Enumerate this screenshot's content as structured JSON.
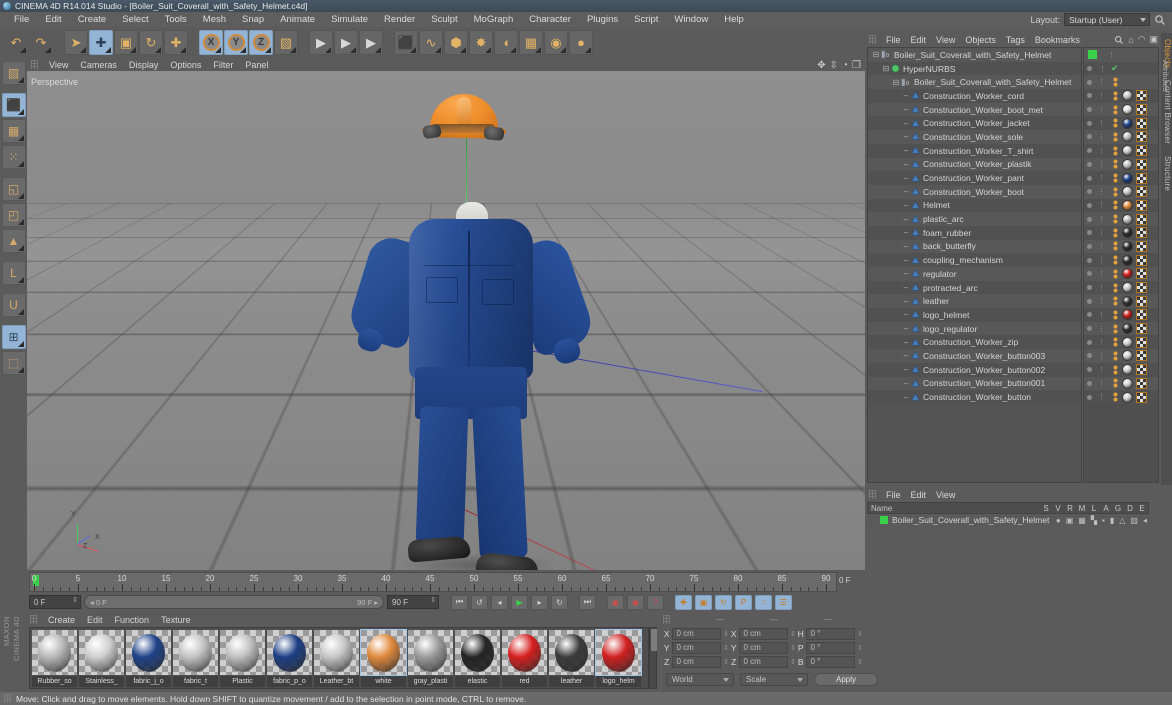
{
  "window": {
    "title": "CINEMA 4D R14.014 Studio - [Boiler_Suit_Coverall_with_Safety_Helmet.c4d]",
    "app_icon": "c4d-logo-icon"
  },
  "menubar": {
    "items": [
      "File",
      "Edit",
      "Create",
      "Select",
      "Tools",
      "Mesh",
      "Snap",
      "Animate",
      "Simulate",
      "Render",
      "Sculpt",
      "MoGraph",
      "Character",
      "Plugins",
      "Script",
      "Window",
      "Help"
    ]
  },
  "layout": {
    "label": "Layout:",
    "value": "Startup (User)"
  },
  "toolbar": {
    "groups": [
      {
        "buttons": [
          {
            "name": "undo-button",
            "glyph": "↶",
            "selected": false
          },
          {
            "name": "redo-button",
            "glyph": "↷",
            "selected": false
          }
        ]
      },
      {
        "buttons": [
          {
            "name": "live-selection-tool",
            "glyph": "➤",
            "selected": false
          },
          {
            "name": "move-tool",
            "glyph": "✚",
            "selected": true
          },
          {
            "name": "scale-tool",
            "glyph": "▣",
            "selected": false
          },
          {
            "name": "rotate-tool",
            "glyph": "↻",
            "selected": false
          },
          {
            "name": "add-point-tool",
            "glyph": "✚",
            "selected": false
          }
        ]
      },
      {
        "buttons": [
          {
            "name": "lock-x-axis-button",
            "glyph": "X",
            "selected": true
          },
          {
            "name": "lock-y-axis-button",
            "glyph": "Y",
            "selected": true
          },
          {
            "name": "lock-z-axis-button",
            "glyph": "Z",
            "selected": true
          },
          {
            "name": "world-object-coordinate-button",
            "glyph": "▧",
            "selected": false
          }
        ]
      },
      {
        "buttons": [
          {
            "name": "render-view-button",
            "glyph": "▶",
            "selected": false
          },
          {
            "name": "render-region-button",
            "glyph": "▶",
            "selected": false
          },
          {
            "name": "render-settings-button",
            "glyph": "▶",
            "selected": false
          }
        ]
      },
      {
        "buttons": [
          {
            "name": "add-cube-object-button",
            "glyph": "⬛",
            "selected": false
          },
          {
            "name": "add-spline-button",
            "glyph": "∿",
            "selected": false
          },
          {
            "name": "add-generator-button",
            "glyph": "⬢",
            "selected": false
          },
          {
            "name": "add-deformer-button",
            "glyph": "✸",
            "selected": false
          },
          {
            "name": "add-scene-object-button",
            "glyph": "◖",
            "selected": false
          },
          {
            "name": "add-environment-button",
            "glyph": "▦",
            "selected": false
          },
          {
            "name": "add-camera-button",
            "glyph": "◉",
            "selected": false
          },
          {
            "name": "add-light-button",
            "glyph": "●",
            "selected": false
          }
        ]
      }
    ]
  },
  "left_toolbar": {
    "buttons": [
      {
        "name": "texture-axis-tool",
        "glyph": "▨",
        "selected": false
      },
      {
        "name": "model-mode-button",
        "glyph": "⬛",
        "selected": true
      },
      {
        "name": "texture-mode-button",
        "glyph": "▦",
        "selected": false
      },
      {
        "name": "points-mode-button",
        "glyph": "⁙",
        "selected": false
      },
      {
        "name": "edges-mode-button",
        "glyph": "◱",
        "selected": false
      },
      {
        "name": "polygons-mode-button",
        "glyph": "◰",
        "selected": false
      },
      {
        "name": "object-axis-mode-button",
        "glyph": "▲",
        "selected": false
      },
      {
        "name": "enable-axis-modification-button",
        "glyph": "L",
        "selected": false
      },
      {
        "name": "enable-snapping-button",
        "glyph": "U",
        "selected": false
      },
      {
        "name": "workplane-lock-button",
        "glyph": "⊞",
        "selected": true
      },
      {
        "name": "workplane-button",
        "glyph": "⬚",
        "selected": false
      }
    ]
  },
  "viewport": {
    "menu": [
      "View",
      "Cameras",
      "Display",
      "Options",
      "Filter",
      "Panel"
    ],
    "camera_label": "Perspective",
    "nav_icons": [
      "pan-icon",
      "dolly-icon",
      "rotate-icon",
      "maximize-icon"
    ],
    "axis_labels": {
      "y": "Y",
      "x": "X",
      "z": "Z"
    },
    "background_color": "#8b8b8b",
    "suit_color": "#254a90",
    "helmet_color": "#ef8f2c",
    "boot_color": "#1b1b1b"
  },
  "timeline": {
    "start_frame": "0 F",
    "end_frame": "90 F",
    "current_frame": "0 F",
    "preview_min": "0 F",
    "preview_max": "90 F",
    "tick_labels": [
      "0",
      "5",
      "10",
      "15",
      "20",
      "25",
      "30",
      "35",
      "40",
      "45",
      "50",
      "55",
      "60",
      "65",
      "70",
      "75",
      "80",
      "85",
      "90"
    ],
    "transport": [
      {
        "name": "go-to-start-button",
        "glyph": "⏮"
      },
      {
        "name": "play-backwards-loop-button",
        "glyph": "↺"
      },
      {
        "name": "go-to-previous-frame-button",
        "glyph": "◂"
      },
      {
        "name": "play-button",
        "glyph": "▶",
        "active": true
      },
      {
        "name": "go-to-next-frame-button",
        "glyph": "▸"
      },
      {
        "name": "loop-button",
        "glyph": "↻"
      },
      {
        "name": "go-to-end-button",
        "glyph": "⏭"
      },
      {
        "name": "record-active-objects-button",
        "glyph": "◉"
      },
      {
        "name": "autokeying-button",
        "glyph": "◉"
      },
      {
        "name": "keyframe-selection-button",
        "glyph": "?"
      },
      {
        "name": "position-key-button",
        "glyph": "✚",
        "on": true
      },
      {
        "name": "scale-key-button",
        "glyph": "▣",
        "on": true
      },
      {
        "name": "rotation-key-button",
        "glyph": "↻",
        "on": true
      },
      {
        "name": "parameter-key-button",
        "glyph": "P",
        "on": true
      },
      {
        "name": "point-level-animation-button",
        "glyph": "⁙",
        "on": true
      },
      {
        "name": "timeline-view-button",
        "glyph": "☰",
        "on": true
      }
    ]
  },
  "material_manager": {
    "menu": [
      "Create",
      "Edit",
      "Function",
      "Texture"
    ],
    "materials": [
      {
        "name": "Rubber_so",
        "color": "#b9b9b9",
        "selected": false
      },
      {
        "name": "Stainless_",
        "color": "#cfcfcf",
        "selected": false
      },
      {
        "name": "fabric_j_o",
        "color": "#1f4288",
        "selected": false
      },
      {
        "name": "fabric_t",
        "color": "#c3c3c3",
        "selected": false
      },
      {
        "name": "Plastic",
        "color": "#c0c0c0",
        "selected": false
      },
      {
        "name": "fabric_p_o",
        "color": "#1d3f84",
        "selected": false
      },
      {
        "name": "Leather_bt",
        "color": "#c6c6c6",
        "selected": false
      },
      {
        "name": "white",
        "color": "#e08a3d",
        "selected": true
      },
      {
        "name": "gray_plasti",
        "color": "#9a9a9a",
        "selected": false
      },
      {
        "name": "elastic",
        "color": "#242424",
        "selected": false
      },
      {
        "name": "red",
        "color": "#d61f1f",
        "selected": false
      },
      {
        "name": "leather",
        "color": "#3b3b3b",
        "selected": false
      },
      {
        "name": "logo_helm",
        "color": "#cf1f1f",
        "selected": true
      }
    ]
  },
  "coordinates": {
    "position": {
      "label_x": "X",
      "x": "0 cm",
      "label_y": "Y",
      "y": "0 cm",
      "label_z": "Z",
      "z": "0 cm"
    },
    "size": {
      "label_x": "X",
      "x": "0 cm",
      "label_y": "Y",
      "y": "0 cm",
      "label_z": "Z",
      "z": "0 cm"
    },
    "rotation": {
      "label_h": "H",
      "h": "0 °",
      "label_p": "P",
      "p": "0 °",
      "label_b": "B",
      "b": "0 °"
    },
    "system": "World",
    "mode": "Scale",
    "apply_label": "Apply",
    "column_headers": [
      "—",
      "—",
      "—"
    ]
  },
  "object_manager": {
    "menu": [
      "File",
      "Edit",
      "View",
      "Objects",
      "Tags",
      "Bookmarks"
    ],
    "header_icons": [
      "search-icon",
      "home-icon",
      "eye-icon",
      "new-object-icon"
    ],
    "rows": [
      {
        "label": "Boiler_Suit_Coverall_with_Safety_Helmet",
        "indent": 0,
        "icon": "null-object-icon",
        "layer_color": "#3ad14a",
        "tags": []
      },
      {
        "label": "HyperNURBS",
        "indent": 1,
        "icon": "hypernurbs-icon",
        "tags": [
          "check"
        ]
      },
      {
        "label": "Boiler_Suit_Coverall_with_Safety_Helmet",
        "indent": 2,
        "icon": "null-object-icon",
        "tags": [
          "dots"
        ]
      },
      {
        "label": "Construction_Worker_cord",
        "indent": 3,
        "icon": "polygon-object-icon",
        "tags": [
          "dots",
          "mat-light",
          "uv"
        ],
        "mat": "#c8c8c8"
      },
      {
        "label": "Construction_Worker_boot_met",
        "indent": 3,
        "icon": "polygon-object-icon",
        "tags": [
          "dots",
          "mat",
          "uv"
        ],
        "mat": "#dedede"
      },
      {
        "label": "Construction_Worker_jacket",
        "indent": 3,
        "icon": "polygon-object-icon",
        "tags": [
          "dots",
          "mat",
          "uv"
        ],
        "mat": "#1f4288"
      },
      {
        "label": "Construction_Worker_sole",
        "indent": 3,
        "icon": "polygon-object-icon",
        "tags": [
          "dots",
          "mat",
          "uv"
        ],
        "mat": "#bfbfbf"
      },
      {
        "label": "Construction_Worker_T_shirt",
        "indent": 3,
        "icon": "polygon-object-icon",
        "tags": [
          "dots",
          "mat",
          "uv"
        ],
        "mat": "#cccccc"
      },
      {
        "label": "Construction_Worker_plastik",
        "indent": 3,
        "icon": "polygon-object-icon",
        "tags": [
          "dots",
          "mat",
          "uv"
        ],
        "mat": "#c2c2c2"
      },
      {
        "label": "Construction_Worker_pant",
        "indent": 3,
        "icon": "polygon-object-icon",
        "tags": [
          "dots",
          "mat",
          "uv"
        ],
        "mat": "#1d3f84"
      },
      {
        "label": "Construction_Worker_boot",
        "indent": 3,
        "icon": "polygon-object-icon",
        "tags": [
          "dots",
          "mat",
          "uv"
        ],
        "mat": "#c5c5c5"
      },
      {
        "label": "Helmet",
        "indent": 3,
        "icon": "polygon-object-icon",
        "tags": [
          "dots",
          "mat",
          "uv"
        ],
        "mat": "#e08a3d"
      },
      {
        "label": "plastic_arc",
        "indent": 3,
        "icon": "polygon-object-icon",
        "tags": [
          "dots",
          "mat",
          "uv"
        ],
        "mat": "#bdbdbd"
      },
      {
        "label": "foam_rubber",
        "indent": 3,
        "icon": "polygon-object-icon",
        "tags": [
          "dots",
          "mat",
          "uv"
        ],
        "mat": "#2a2a2a"
      },
      {
        "label": "back_butterfly",
        "indent": 3,
        "icon": "polygon-object-icon",
        "tags": [
          "dots",
          "mat",
          "uv"
        ],
        "mat": "#2c2c2c"
      },
      {
        "label": "coupling_mechanism",
        "indent": 3,
        "icon": "polygon-object-icon",
        "tags": [
          "dots",
          "mat",
          "uv"
        ],
        "mat": "#2b2b2b"
      },
      {
        "label": "regulator",
        "indent": 3,
        "icon": "polygon-object-icon",
        "tags": [
          "dots",
          "mat",
          "uv"
        ],
        "mat": "#d61f1f"
      },
      {
        "label": "protracted_arc",
        "indent": 3,
        "icon": "polygon-object-icon",
        "tags": [
          "dots",
          "mat",
          "uv"
        ],
        "mat": "#c9c9c9"
      },
      {
        "label": "leather",
        "indent": 3,
        "icon": "polygon-object-icon",
        "tags": [
          "dots",
          "mat",
          "uv"
        ],
        "mat": "#303030"
      },
      {
        "label": "logo_helmet",
        "indent": 3,
        "icon": "polygon-object-icon",
        "tags": [
          "dots",
          "mat",
          "uv"
        ],
        "mat": "#cf1f1f"
      },
      {
        "label": "logo_regulator",
        "indent": 3,
        "icon": "polygon-object-icon",
        "tags": [
          "dots",
          "mat",
          "uv"
        ],
        "mat": "#303030"
      },
      {
        "label": "Construction_Worker_zip",
        "indent": 3,
        "icon": "polygon-object-icon",
        "tags": [
          "dots",
          "mat",
          "uv"
        ],
        "mat": "#d2d2d2"
      },
      {
        "label": "Construction_Worker_button003",
        "indent": 3,
        "icon": "polygon-object-icon",
        "tags": [
          "dots",
          "mat",
          "uv"
        ],
        "mat": "#d2d2d2"
      },
      {
        "label": "Construction_Worker_button002",
        "indent": 3,
        "icon": "polygon-object-icon",
        "tags": [
          "dots",
          "mat",
          "uv"
        ],
        "mat": "#d2d2d2"
      },
      {
        "label": "Construction_Worker_button001",
        "indent": 3,
        "icon": "polygon-object-icon",
        "tags": [
          "dots",
          "mat",
          "uv"
        ],
        "mat": "#d2d2d2"
      },
      {
        "label": "Construction_Worker_button",
        "indent": 3,
        "icon": "polygon-object-icon",
        "tags": [
          "dots",
          "mat",
          "uv"
        ],
        "mat": "#d2d2d2"
      }
    ],
    "side_tabs": [
      {
        "label": "Objects",
        "active": true
      },
      {
        "label": "Content Browser",
        "active": false
      },
      {
        "label": "Structure",
        "active": false
      }
    ]
  },
  "layer_manager": {
    "menu": [
      "File",
      "Edit",
      "View"
    ],
    "columns": [
      "Name",
      "S",
      "V",
      "R",
      "M",
      "L",
      "A",
      "G",
      "D",
      "E"
    ],
    "rows": [
      {
        "name": "Boiler_Suit_Coverall_with_Safety_Helmet",
        "color": "#3ad14a"
      }
    ]
  },
  "attribute_tab": {
    "label": "Attributes"
  },
  "branding": {
    "line1": "MAXON",
    "line2": "CINEMA 4D"
  },
  "statusbar": {
    "text": "Move: Click and drag to move elements. Hold down SHIFT to quantize movement / add to the selection in point mode, CTRL to remove."
  }
}
